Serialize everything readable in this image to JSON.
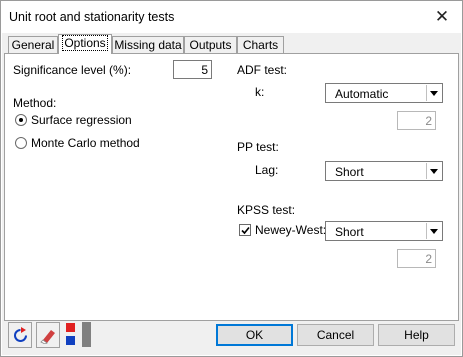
{
  "window": {
    "title": "Unit root and stationarity tests",
    "close_glyph": "✕"
  },
  "tabs": [
    {
      "label": "General"
    },
    {
      "label": "Options",
      "active": true
    },
    {
      "label": "Missing data"
    },
    {
      "label": "Outputs"
    },
    {
      "label": "Charts"
    }
  ],
  "options": {
    "significance_label": "Significance level (%):",
    "significance_value": "5",
    "method_label": "Method:",
    "methods": [
      {
        "label": "Surface regression",
        "selected": true
      },
      {
        "label": "Monte Carlo method",
        "selected": false
      }
    ],
    "adf": {
      "header": "ADF test:",
      "k_label": "k:",
      "k_value": "Automatic",
      "k_number": "2"
    },
    "pp": {
      "header": "PP test:",
      "lag_label": "Lag:",
      "lag_value": "Short"
    },
    "kpss": {
      "header": "KPSS test:",
      "newey_label": "Newey-West:",
      "newey_checked": true,
      "newey_value": "Short",
      "kpss_number": "2"
    }
  },
  "buttons": {
    "ok": "OK",
    "cancel": "Cancel",
    "help": "Help"
  },
  "toolbar": {
    "icons": [
      "reset-icon",
      "eraser-icon",
      "color-layout-icon"
    ]
  },
  "colors": {
    "accent": "#0078d7",
    "red": "#e02020",
    "blue": "#1040c0",
    "gray": "#808080"
  }
}
